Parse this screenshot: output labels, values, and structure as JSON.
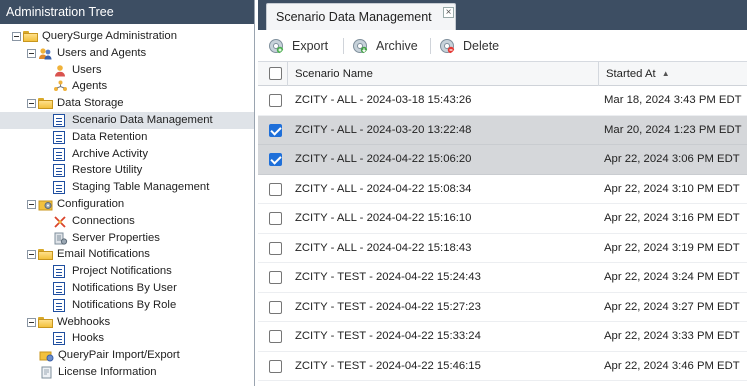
{
  "left_panel": {
    "title": "Administration Tree",
    "tree": [
      {
        "label": "QuerySurge Administration",
        "icon": "folder-icon",
        "level": 0,
        "expander": true
      },
      {
        "label": "Users and Agents",
        "icon": "users-icon",
        "level": 1,
        "expander": true
      },
      {
        "label": "Users",
        "icon": "user-icon",
        "level": 2
      },
      {
        "label": "Agents",
        "icon": "agents-icon",
        "level": 2
      },
      {
        "label": "Data Storage",
        "icon": "folder-icon",
        "level": 1,
        "expander": true
      },
      {
        "label": "Scenario Data Management",
        "icon": "page-icon",
        "level": 2,
        "selected": true
      },
      {
        "label": "Data Retention",
        "icon": "page-icon",
        "level": 2
      },
      {
        "label": "Archive Activity",
        "icon": "page-icon",
        "level": 2
      },
      {
        "label": "Restore Utility",
        "icon": "page-icon",
        "level": 2
      },
      {
        "label": "Staging Table Management",
        "icon": "page-icon",
        "level": 2
      },
      {
        "label": "Configuration",
        "icon": "config-icon",
        "level": 1,
        "expander": true
      },
      {
        "label": "Connections",
        "icon": "connections-icon",
        "level": 2
      },
      {
        "label": "Server Properties",
        "icon": "server-icon",
        "level": 2
      },
      {
        "label": "Email Notifications",
        "icon": "folder-icon",
        "level": 1,
        "expander": true
      },
      {
        "label": "Project Notifications",
        "icon": "page-icon",
        "level": 2
      },
      {
        "label": "Notifications By User",
        "icon": "page-icon",
        "level": 2
      },
      {
        "label": "Notifications By Role",
        "icon": "page-icon",
        "level": 2
      },
      {
        "label": "Webhooks",
        "icon": "folder-icon",
        "level": 1,
        "expander": true
      },
      {
        "label": "Hooks",
        "icon": "page-icon",
        "level": 2
      },
      {
        "label": "QueryPair Import/Export",
        "icon": "import-export-icon",
        "level": 1
      },
      {
        "label": "License Information",
        "icon": "license-icon",
        "level": 1
      }
    ]
  },
  "main": {
    "tab": {
      "label": "Scenario Data Management",
      "close": "×"
    },
    "toolbar": {
      "export_label": "Export",
      "archive_label": "Archive",
      "delete_label": "Delete"
    },
    "table": {
      "col_name": "Scenario Name",
      "col_started": "Started At",
      "sort_indicator": "▲",
      "rows": [
        {
          "name": "ZCITY - ALL - 2024-03-18 15:43:26",
          "started": "Mar 18, 2024 3:43 PM EDT",
          "checked": false
        },
        {
          "name": "ZCITY - ALL - 2024-03-20 13:22:48",
          "started": "Mar 20, 2024 1:23 PM EDT",
          "checked": true
        },
        {
          "name": "ZCITY - ALL - 2024-04-22 15:06:20",
          "started": "Apr 22, 2024 3:06 PM EDT",
          "checked": true
        },
        {
          "name": "ZCITY - ALL - 2024-04-22 15:08:34",
          "started": "Apr 22, 2024 3:10 PM EDT",
          "checked": false
        },
        {
          "name": "ZCITY - ALL - 2024-04-22 15:16:10",
          "started": "Apr 22, 2024 3:16 PM EDT",
          "checked": false
        },
        {
          "name": "ZCITY - ALL - 2024-04-22 15:18:43",
          "started": "Apr 22, 2024 3:19 PM EDT",
          "checked": false
        },
        {
          "name": "ZCITY - TEST - 2024-04-22 15:24:43",
          "started": "Apr 22, 2024 3:24 PM EDT",
          "checked": false
        },
        {
          "name": "ZCITY - TEST - 2024-04-22 15:27:23",
          "started": "Apr 22, 2024 3:27 PM EDT",
          "checked": false
        },
        {
          "name": "ZCITY - TEST - 2024-04-22 15:33:24",
          "started": "Apr 22, 2024 3:33 PM EDT",
          "checked": false
        },
        {
          "name": "ZCITY - TEST - 2024-04-22 15:46:15",
          "started": "Apr 22, 2024 3:46 PM EDT",
          "checked": false
        }
      ]
    }
  },
  "colors": {
    "header_bg": "#3d4e63",
    "selected_row": "#d5d7da",
    "checkbox_checked": "#1e6fd9"
  }
}
